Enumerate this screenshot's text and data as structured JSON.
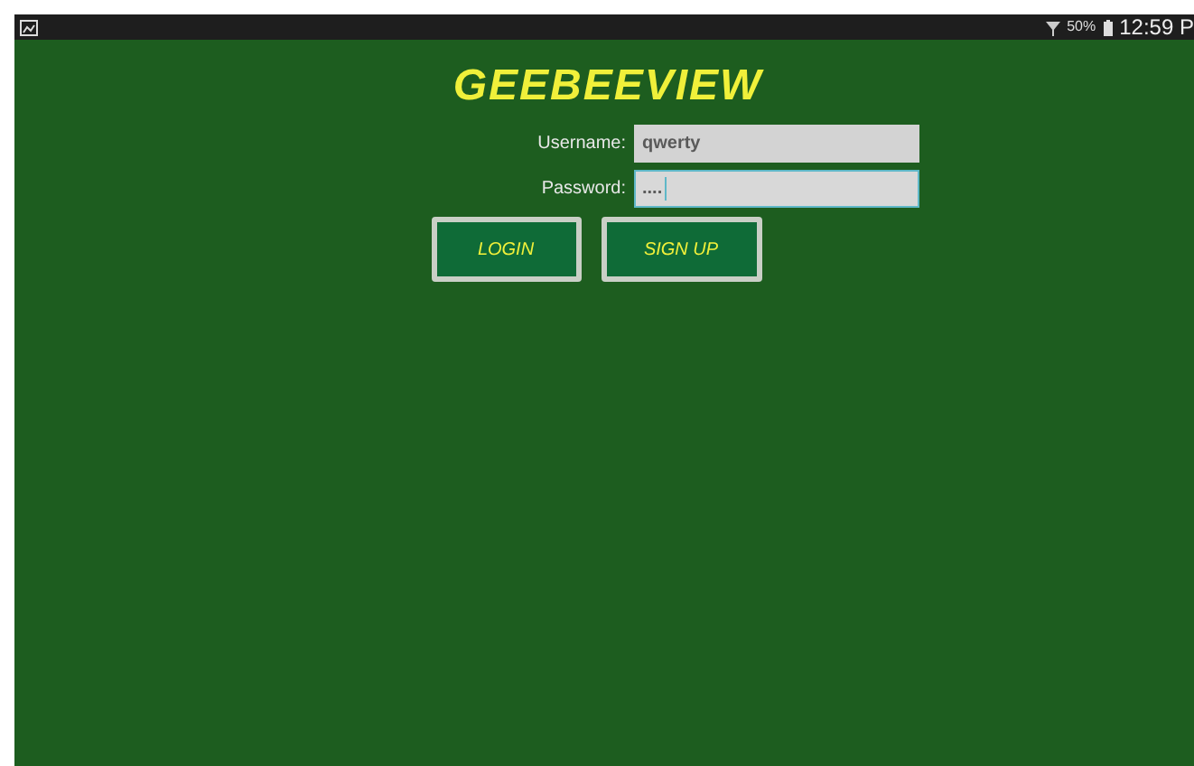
{
  "status_bar": {
    "battery_text": "50%",
    "time": "12:59 P"
  },
  "app": {
    "title": "GEEBEEVIEW"
  },
  "form": {
    "fields": [
      {
        "label": "Username:",
        "value": "qwerty",
        "focused": false
      },
      {
        "label": "Password:",
        "value": "....",
        "focused": true
      }
    ],
    "buttons": [
      "LOGIN",
      "SIGN UP"
    ]
  }
}
